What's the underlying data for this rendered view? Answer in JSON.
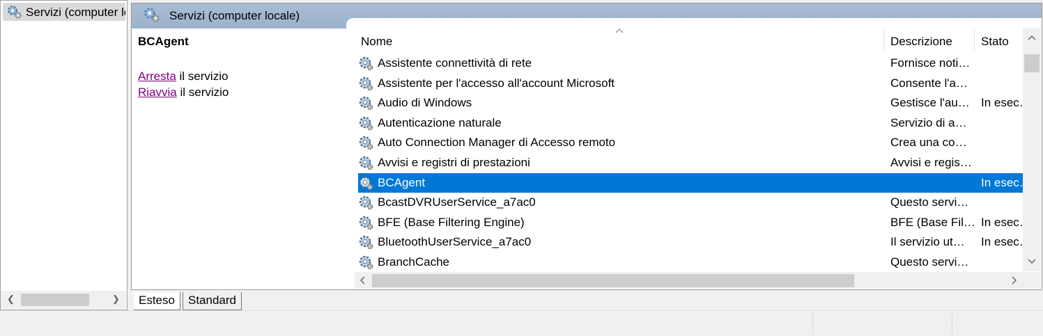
{
  "tree": {
    "root_label": "Servizi (computer locale)"
  },
  "header": {
    "title": "Servizi (computer locale)"
  },
  "detail": {
    "service_name": "BCAgent",
    "stop_link": "Arresta",
    "stop_suffix": " il servizio",
    "restart_link": "Riavvia",
    "restart_suffix": " il servizio"
  },
  "columns": {
    "name": "Nome",
    "description": "Descrizione",
    "status": "Stato"
  },
  "services": [
    {
      "name": "Assistente connettività di rete",
      "description": "Fornisce noti…",
      "status": ""
    },
    {
      "name": "Assistente per l'accesso all'account Microsoft",
      "description": "Consente l'a…",
      "status": ""
    },
    {
      "name": "Audio di Windows",
      "description": "Gestisce l'au…",
      "status": "In esec…"
    },
    {
      "name": "Autenticazione naturale",
      "description": "Servizio di a…",
      "status": ""
    },
    {
      "name": "Auto Connection Manager di Accesso remoto",
      "description": "Crea una co…",
      "status": ""
    },
    {
      "name": "Avvisi e registri di prestazioni",
      "description": "Avvisi e regis…",
      "status": ""
    },
    {
      "name": "BCAgent",
      "description": "",
      "status": "In esec…",
      "selected": true
    },
    {
      "name": "BcastDVRUserService_a7ac0",
      "description": "Questo servi…",
      "status": ""
    },
    {
      "name": "BFE (Base Filtering Engine)",
      "description": "BFE (Base Fil…",
      "status": "In esec…"
    },
    {
      "name": "BluetoothUserService_a7ac0",
      "description": "Il servizio ut…",
      "status": "In esec…"
    },
    {
      "name": "BranchCache",
      "description": "Questo servi…",
      "status": ""
    }
  ],
  "tabs": {
    "extended": "Esteso",
    "standard": "Standard"
  },
  "colors": {
    "selection": "#0078d7",
    "header_band": "#a9bdd3",
    "link": "#800080"
  },
  "icons": {
    "service": "gear-icon",
    "sort": "sort-ascending-icon"
  }
}
